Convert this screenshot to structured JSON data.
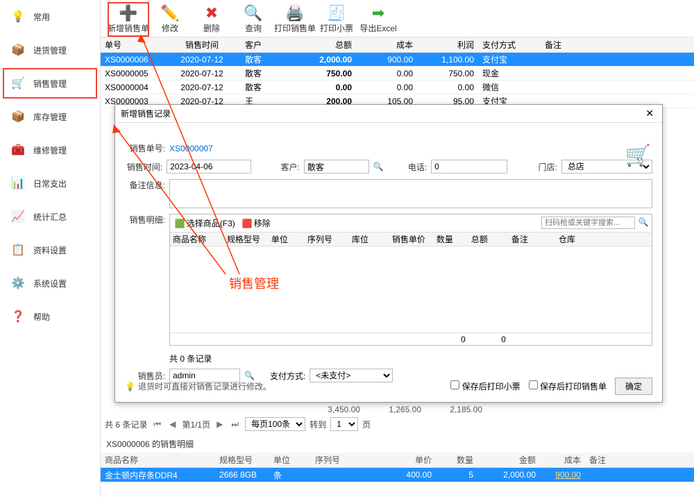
{
  "sidebar": [
    {
      "icon": "💡",
      "label": "常用"
    },
    {
      "icon": "📦",
      "label": "进货管理"
    },
    {
      "icon": "🛒",
      "label": "销售管理"
    },
    {
      "icon": "📦",
      "label": "库存管理"
    },
    {
      "icon": "🧰",
      "label": "维修管理"
    },
    {
      "icon": "📊",
      "label": "日常支出"
    },
    {
      "icon": "📈",
      "label": "统计汇总"
    },
    {
      "icon": "📋",
      "label": "资料设置"
    },
    {
      "icon": "⚙️",
      "label": "系统设置"
    },
    {
      "icon": "❓",
      "label": "帮助"
    }
  ],
  "toolbar": [
    {
      "icon": "➕",
      "label": "新增销售单",
      "color": "#3a3"
    },
    {
      "icon": "✏️",
      "label": "修改"
    },
    {
      "icon": "✖",
      "label": "删除",
      "color": "#d33"
    },
    {
      "icon": "🔍",
      "label": "查询",
      "color": "#3a3"
    },
    {
      "icon": "🖨️",
      "label": "打印销售单"
    },
    {
      "icon": "🧾",
      "label": "打印小票"
    },
    {
      "icon": "➡",
      "label": "导出Excel",
      "color": "#3a3"
    }
  ],
  "gridCols": {
    "no": "单号",
    "time": "销售时间",
    "cust": "客户",
    "total": "总额",
    "cost": "成本",
    "profit": "利润",
    "pay": "支付方式",
    "remark": "备注"
  },
  "rows": [
    {
      "no": "XS0000006",
      "time": "2020-07-12",
      "cust": "散客",
      "total": "2,000.00",
      "cost": "900.00",
      "profit": "1,100.00",
      "pay": "支付宝"
    },
    {
      "no": "XS0000005",
      "time": "2020-07-12",
      "cust": "散客",
      "total": "750.00",
      "cost": "0.00",
      "profit": "750.00",
      "pay": "现金"
    },
    {
      "no": "XS0000004",
      "time": "2020-07-12",
      "cust": "散客",
      "total": "0.00",
      "cost": "0.00",
      "profit": "0.00",
      "pay": "微信"
    },
    {
      "no": "XS0000003",
      "time": "2020-07-12",
      "cust": "王",
      "total": "200.00",
      "cost": "105.00",
      "profit": "95.00",
      "pay": "支付宝"
    }
  ],
  "totals": {
    "total": "3,450.00",
    "cost": "1,265.00",
    "profit": "2,185.00"
  },
  "pager": {
    "totalLabel": "共 6 条记录",
    "pageLabel": "第1/1页",
    "perPage": "每页100条",
    "gotoLabel": "转到",
    "gotoVal": "1",
    "pageSuffix": "页"
  },
  "detailTitle": "XS0000006 的销售明细",
  "detailCols": {
    "name": "商品名称",
    "spec": "规格型号",
    "unit": "单位",
    "serial": "序列号",
    "price": "单价",
    "qty": "数量",
    "amount": "金额",
    "cost": "成本",
    "remark": "备注"
  },
  "detailRow": {
    "name": "金士顿内存条DDR4",
    "spec": "2666 8GB",
    "unit": "条",
    "serial": "",
    "price": "400.00",
    "qty": "5",
    "amount": "2,000.00",
    "cost": "900.00"
  },
  "dialog": {
    "title": "新增销售记录",
    "labels": {
      "orderNo": "销售单号:",
      "time": "销售时间:",
      "cust": "客户:",
      "phone": "电话:",
      "store": "门店:",
      "memo": "备注信息:",
      "detail": "销售明细:",
      "seller": "销售员:",
      "payMode": "支付方式:"
    },
    "orderNo": "XS0000007",
    "time": "2023-04-06",
    "cust": "散客",
    "phone": "0",
    "store": "总店",
    "selectGoods": "选择商品(F3)",
    "removeGoods": "移除",
    "scanPlaceholder": "扫码枪或关键字搜索...",
    "detailCols": {
      "name": "商品名称",
      "spec": "规格型号",
      "unit": "单位",
      "serial": "序列号",
      "warehouse": "库位",
      "price": "销售单价",
      "qty": "数量",
      "total": "总额",
      "remark": "备注",
      "store": "仓库"
    },
    "footQty": "0",
    "footTotal": "0",
    "countLabel": "共 0 条记录",
    "seller": "admin",
    "payMode": "<未支付>",
    "chkReceipt": "保存后打印小票",
    "chkOrder": "保存后打印销售单",
    "ok": "确定",
    "tip": "退货时可直接对销售记录进行修改。"
  },
  "annotation": "销售管理"
}
